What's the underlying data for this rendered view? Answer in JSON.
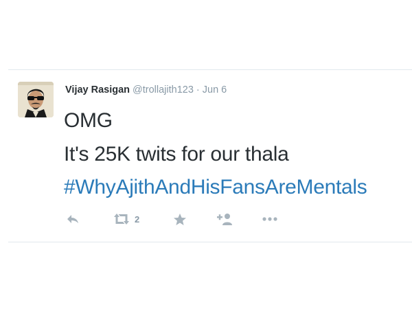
{
  "tweet": {
    "fullname": "Vijay Rasigan",
    "screen_name": "@trollajith123",
    "separator": "·",
    "timestamp": "Jun 6",
    "lines": [
      "OMG",
      "It's 25K twits for our thala"
    ],
    "hashtag": "#WhyAjithAndHisFansAreMentals"
  },
  "actions": {
    "reply_icon": "reply-icon",
    "retweet_icon": "retweet-icon",
    "retweet_count": "2",
    "favorite_icon": "star-icon",
    "follow_icon": "follow-icon",
    "more_icon": "more-dots-icon"
  },
  "colors": {
    "link": "#2b7bb9",
    "text": "#292f33",
    "muted": "#8899a6",
    "action_icon": "#a8b4bd",
    "border": "#e1e8ed"
  }
}
